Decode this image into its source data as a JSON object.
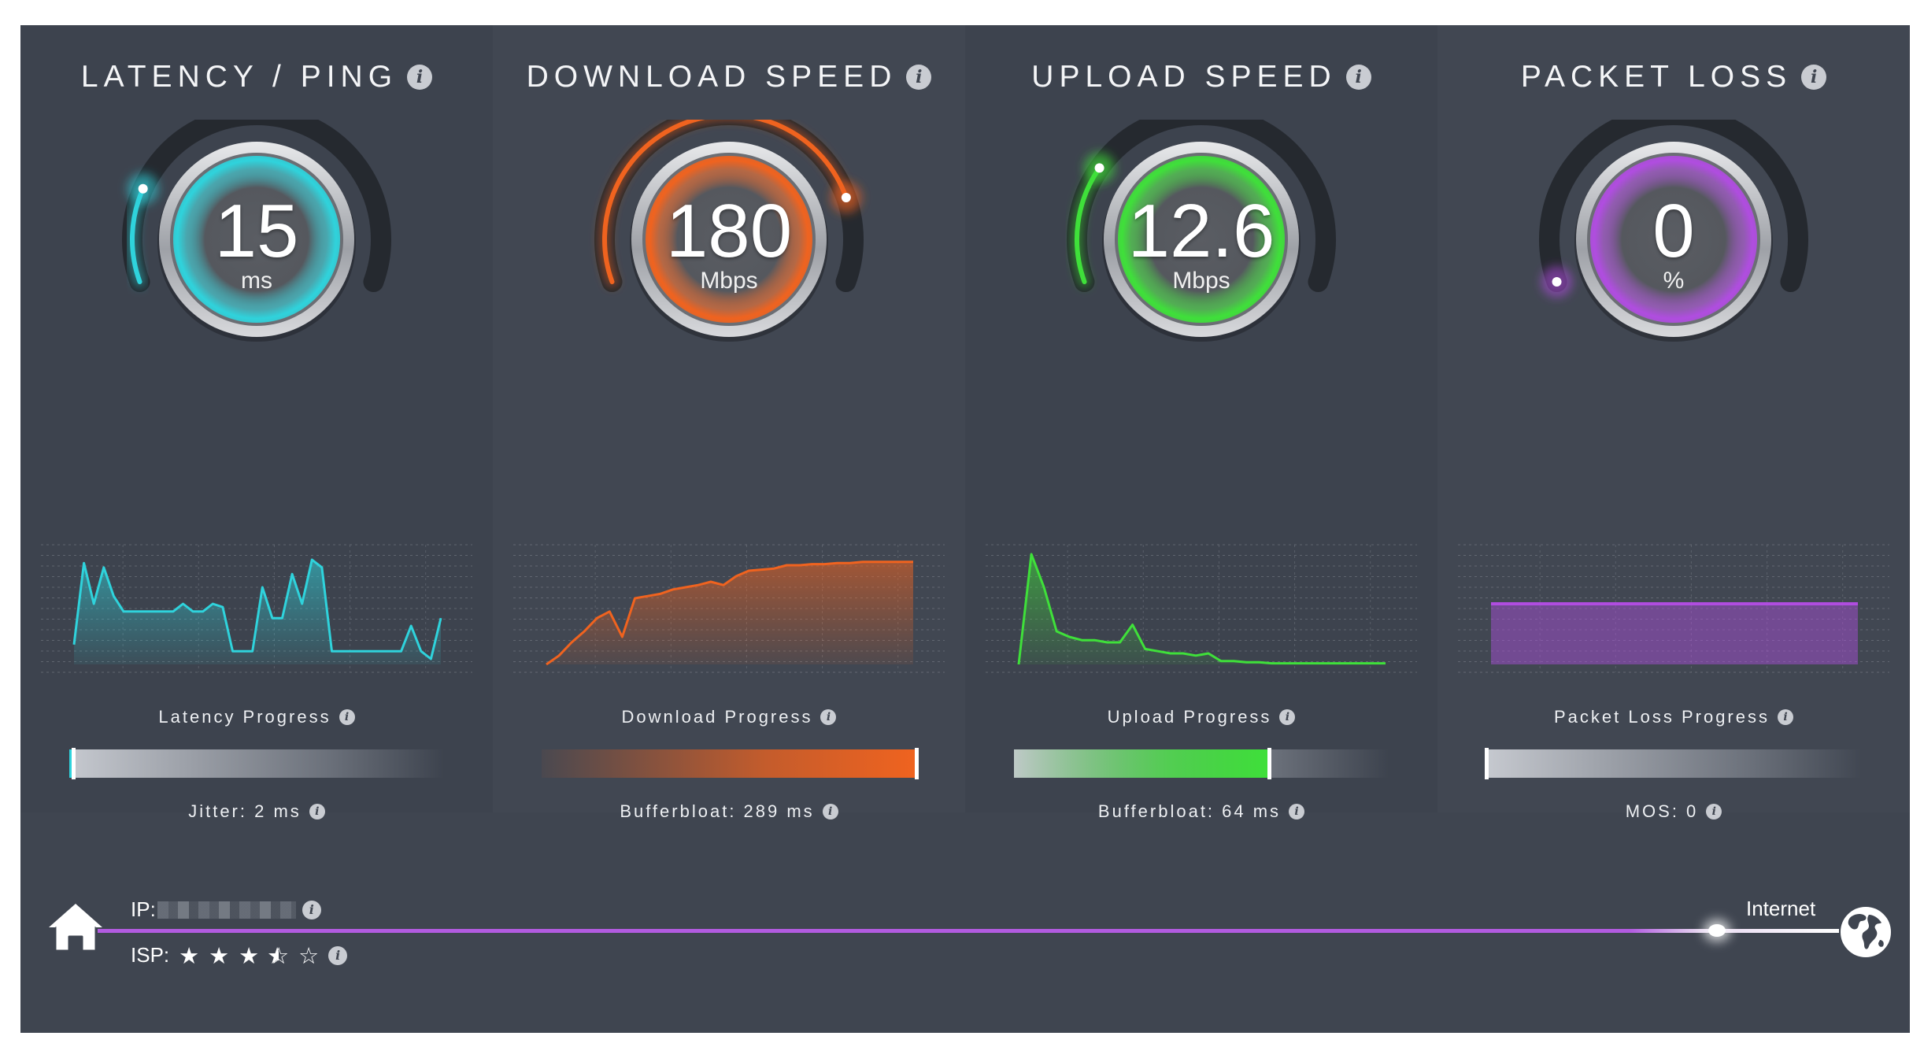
{
  "panels": [
    {
      "id": "latency",
      "title": "LATENCY / PING",
      "value": "15",
      "unit": "ms",
      "color": "#2fd3dc",
      "gauge_fraction": 0.2,
      "progress_label": "Latency Progress",
      "progress_fraction": 0.01,
      "sub_label": "Jitter: 2 ms",
      "series": [
        0.18,
        0.92,
        0.55,
        0.88,
        0.62,
        0.48,
        0.48,
        0.48,
        0.48,
        0.48,
        0.48,
        0.55,
        0.48,
        0.48,
        0.55,
        0.52,
        0.12,
        0.12,
        0.12,
        0.7,
        0.42,
        0.42,
        0.82,
        0.55,
        0.95,
        0.88,
        0.12,
        0.12,
        0.12,
        0.12,
        0.12,
        0.12,
        0.12,
        0.12,
        0.35,
        0.12,
        0.05,
        0.42
      ]
    },
    {
      "id": "download",
      "title": "DOWNLOAD SPEED",
      "value": "180",
      "unit": "Mbps",
      "color": "#f0631f",
      "gauge_fraction": 0.82,
      "progress_label": "Download Progress",
      "progress_fraction": 1.0,
      "sub_label": "Bufferbloat: 289 ms",
      "series": [
        0.0,
        0.08,
        0.2,
        0.3,
        0.42,
        0.48,
        0.25,
        0.6,
        0.62,
        0.64,
        0.68,
        0.7,
        0.72,
        0.75,
        0.72,
        0.8,
        0.85,
        0.86,
        0.87,
        0.9,
        0.9,
        0.91,
        0.91,
        0.92,
        0.92,
        0.93,
        0.93,
        0.93,
        0.93,
        0.93
      ]
    },
    {
      "id": "upload",
      "title": "UPLOAD SPEED",
      "value": "12.6",
      "unit": "Mbps",
      "color": "#3fe03a",
      "gauge_fraction": 0.25,
      "progress_label": "Upload Progress",
      "progress_fraction": 0.68,
      "sub_label": "Bufferbloat: 64 ms",
      "series": [
        0.0,
        1.0,
        0.7,
        0.3,
        0.25,
        0.22,
        0.22,
        0.2,
        0.2,
        0.36,
        0.14,
        0.12,
        0.1,
        0.1,
        0.08,
        0.1,
        0.03,
        0.03,
        0.02,
        0.02,
        0.01,
        0.01,
        0.01,
        0.01,
        0.01,
        0.01,
        0.01,
        0.01,
        0.01,
        0.01
      ]
    },
    {
      "id": "packetloss",
      "title": "PACKET LOSS",
      "value": "0",
      "unit": "%",
      "color": "#b04de0",
      "gauge_fraction": 0.0,
      "progress_label": "Packet Loss Progress",
      "progress_fraction": 0.0,
      "sub_label": "MOS: 0",
      "series": [
        0.55,
        0.55,
        0.55,
        0.55,
        0.55,
        0.55,
        0.55,
        0.55,
        0.55,
        0.55
      ]
    }
  ],
  "info_glyph": "i",
  "footer": {
    "ip_label": "IP:",
    "isp_label": "ISP:",
    "isp_rating": 3.5,
    "star_full": "★",
    "star_empty": "☆",
    "internet_label": "Internet",
    "home_icon": "home-icon",
    "globe_icon": "globe-icon",
    "connection_progress": 0.93
  }
}
